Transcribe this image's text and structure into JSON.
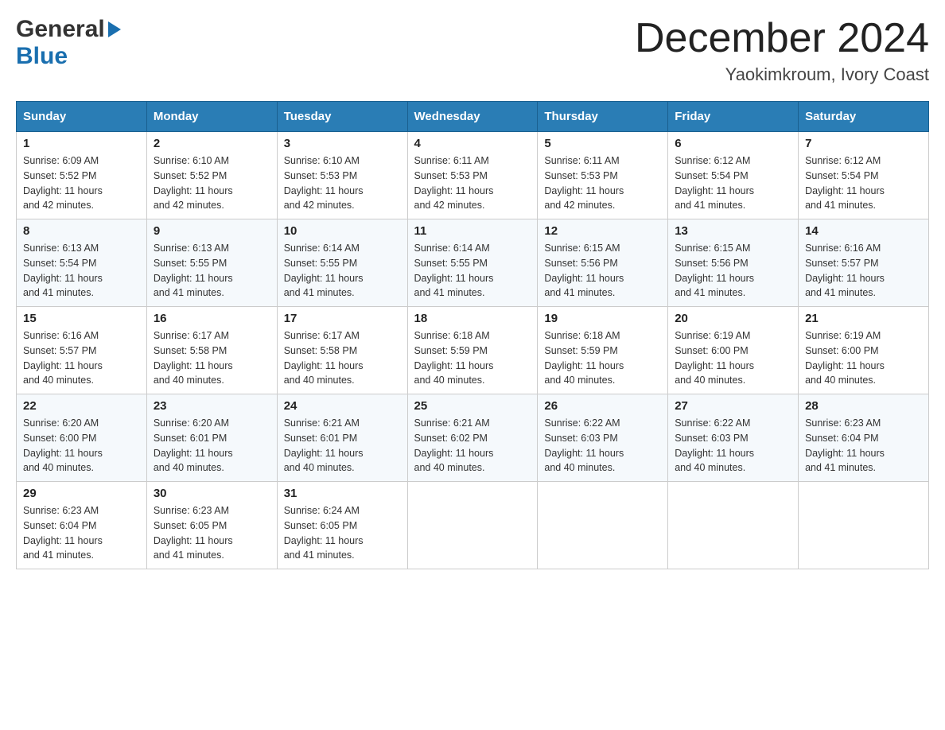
{
  "header": {
    "logo_general": "General",
    "logo_blue": "Blue",
    "month_title": "December 2024",
    "location": "Yaokimkroum, Ivory Coast"
  },
  "days_of_week": [
    "Sunday",
    "Monday",
    "Tuesday",
    "Wednesday",
    "Thursday",
    "Friday",
    "Saturday"
  ],
  "weeks": [
    [
      {
        "day": "1",
        "sunrise": "6:09 AM",
        "sunset": "5:52 PM",
        "daylight": "11 hours and 42 minutes."
      },
      {
        "day": "2",
        "sunrise": "6:10 AM",
        "sunset": "5:52 PM",
        "daylight": "11 hours and 42 minutes."
      },
      {
        "day": "3",
        "sunrise": "6:10 AM",
        "sunset": "5:53 PM",
        "daylight": "11 hours and 42 minutes."
      },
      {
        "day": "4",
        "sunrise": "6:11 AM",
        "sunset": "5:53 PM",
        "daylight": "11 hours and 42 minutes."
      },
      {
        "day": "5",
        "sunrise": "6:11 AM",
        "sunset": "5:53 PM",
        "daylight": "11 hours and 42 minutes."
      },
      {
        "day": "6",
        "sunrise": "6:12 AM",
        "sunset": "5:54 PM",
        "daylight": "11 hours and 41 minutes."
      },
      {
        "day": "7",
        "sunrise": "6:12 AM",
        "sunset": "5:54 PM",
        "daylight": "11 hours and 41 minutes."
      }
    ],
    [
      {
        "day": "8",
        "sunrise": "6:13 AM",
        "sunset": "5:54 PM",
        "daylight": "11 hours and 41 minutes."
      },
      {
        "day": "9",
        "sunrise": "6:13 AM",
        "sunset": "5:55 PM",
        "daylight": "11 hours and 41 minutes."
      },
      {
        "day": "10",
        "sunrise": "6:14 AM",
        "sunset": "5:55 PM",
        "daylight": "11 hours and 41 minutes."
      },
      {
        "day": "11",
        "sunrise": "6:14 AM",
        "sunset": "5:55 PM",
        "daylight": "11 hours and 41 minutes."
      },
      {
        "day": "12",
        "sunrise": "6:15 AM",
        "sunset": "5:56 PM",
        "daylight": "11 hours and 41 minutes."
      },
      {
        "day": "13",
        "sunrise": "6:15 AM",
        "sunset": "5:56 PM",
        "daylight": "11 hours and 41 minutes."
      },
      {
        "day": "14",
        "sunrise": "6:16 AM",
        "sunset": "5:57 PM",
        "daylight": "11 hours and 41 minutes."
      }
    ],
    [
      {
        "day": "15",
        "sunrise": "6:16 AM",
        "sunset": "5:57 PM",
        "daylight": "11 hours and 40 minutes."
      },
      {
        "day": "16",
        "sunrise": "6:17 AM",
        "sunset": "5:58 PM",
        "daylight": "11 hours and 40 minutes."
      },
      {
        "day": "17",
        "sunrise": "6:17 AM",
        "sunset": "5:58 PM",
        "daylight": "11 hours and 40 minutes."
      },
      {
        "day": "18",
        "sunrise": "6:18 AM",
        "sunset": "5:59 PM",
        "daylight": "11 hours and 40 minutes."
      },
      {
        "day": "19",
        "sunrise": "6:18 AM",
        "sunset": "5:59 PM",
        "daylight": "11 hours and 40 minutes."
      },
      {
        "day": "20",
        "sunrise": "6:19 AM",
        "sunset": "6:00 PM",
        "daylight": "11 hours and 40 minutes."
      },
      {
        "day": "21",
        "sunrise": "6:19 AM",
        "sunset": "6:00 PM",
        "daylight": "11 hours and 40 minutes."
      }
    ],
    [
      {
        "day": "22",
        "sunrise": "6:20 AM",
        "sunset": "6:00 PM",
        "daylight": "11 hours and 40 minutes."
      },
      {
        "day": "23",
        "sunrise": "6:20 AM",
        "sunset": "6:01 PM",
        "daylight": "11 hours and 40 minutes."
      },
      {
        "day": "24",
        "sunrise": "6:21 AM",
        "sunset": "6:01 PM",
        "daylight": "11 hours and 40 minutes."
      },
      {
        "day": "25",
        "sunrise": "6:21 AM",
        "sunset": "6:02 PM",
        "daylight": "11 hours and 40 minutes."
      },
      {
        "day": "26",
        "sunrise": "6:22 AM",
        "sunset": "6:03 PM",
        "daylight": "11 hours and 40 minutes."
      },
      {
        "day": "27",
        "sunrise": "6:22 AM",
        "sunset": "6:03 PM",
        "daylight": "11 hours and 40 minutes."
      },
      {
        "day": "28",
        "sunrise": "6:23 AM",
        "sunset": "6:04 PM",
        "daylight": "11 hours and 41 minutes."
      }
    ],
    [
      {
        "day": "29",
        "sunrise": "6:23 AM",
        "sunset": "6:04 PM",
        "daylight": "11 hours and 41 minutes."
      },
      {
        "day": "30",
        "sunrise": "6:23 AM",
        "sunset": "6:05 PM",
        "daylight": "11 hours and 41 minutes."
      },
      {
        "day": "31",
        "sunrise": "6:24 AM",
        "sunset": "6:05 PM",
        "daylight": "11 hours and 41 minutes."
      },
      null,
      null,
      null,
      null
    ]
  ],
  "labels": {
    "sunrise": "Sunrise:",
    "sunset": "Sunset:",
    "daylight": "Daylight:"
  }
}
